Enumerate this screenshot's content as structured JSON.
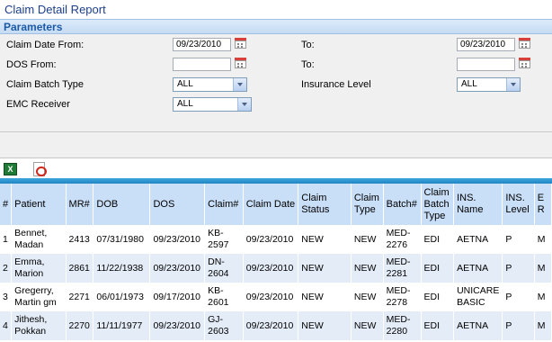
{
  "title": "Claim Detail Report",
  "parameters": {
    "header": "Parameters",
    "claim_date_from": {
      "label": "Claim Date From:",
      "value": "09/23/2010"
    },
    "claim_date_to": {
      "label": "To:",
      "value": "09/23/2010"
    },
    "dos_from": {
      "label": "DOS From:",
      "value": ""
    },
    "dos_to": {
      "label": "To:",
      "value": ""
    },
    "claim_batch_type": {
      "label": "Claim Batch Type",
      "value": "ALL"
    },
    "insurance_level": {
      "label": "Insurance Level",
      "value": "ALL"
    },
    "emc_receiver": {
      "label": "EMC Receiver",
      "value": "ALL"
    }
  },
  "toolbar": {
    "excel_icon": "excel-icon",
    "pdf_icon": "pdf-icon"
  },
  "grid": {
    "columns": [
      "#",
      "Patient",
      "MR#",
      "DOB",
      "DOS",
      "Claim#",
      "Claim Date",
      "Claim Status",
      "Claim Type",
      "Batch#",
      "Claim Batch Type",
      "INS. Name",
      "INS. Level",
      "E R"
    ],
    "rows": [
      {
        "num": "1",
        "patient": "Bennet, Madan",
        "mr": "2413",
        "dob": "07/31/1980",
        "dos": "09/23/2010",
        "claim": "KB-2597",
        "claim_date": "09/23/2010",
        "status": "NEW",
        "type": "NEW",
        "batch": "MED-2276",
        "batch_type": "EDI",
        "ins_name": "AETNA",
        "ins_level": "P",
        "extra": "M"
      },
      {
        "num": "2",
        "patient": "Emma, Marion",
        "mr": "2861",
        "dob": "11/22/1938",
        "dos": "09/23/2010",
        "claim": "DN-2604",
        "claim_date": "09/23/2010",
        "status": "NEW",
        "type": "NEW",
        "batch": "MED-2281",
        "batch_type": "EDI",
        "ins_name": "AETNA",
        "ins_level": "P",
        "extra": "M"
      },
      {
        "num": "3",
        "patient": "Gregerry, Martin gm",
        "mr": "2271",
        "dob": "06/01/1973",
        "dos": "09/17/2010",
        "claim": "KB-2601",
        "claim_date": "09/23/2010",
        "status": "NEW",
        "type": "NEW",
        "batch": "MED-2278",
        "batch_type": "EDI",
        "ins_name": "UNICARE BASIC",
        "ins_level": "P",
        "extra": "M"
      },
      {
        "num": "4",
        "patient": "Jithesh, Pokkan",
        "mr": "2270",
        "dob": "11/11/1977",
        "dos": "09/23/2010",
        "claim": "GJ-2603",
        "claim_date": "09/23/2010",
        "status": "NEW",
        "type": "NEW",
        "batch": "MED-2280",
        "batch_type": "EDI",
        "ins_name": "AETNA",
        "ins_level": "P",
        "extra": "M"
      }
    ]
  }
}
